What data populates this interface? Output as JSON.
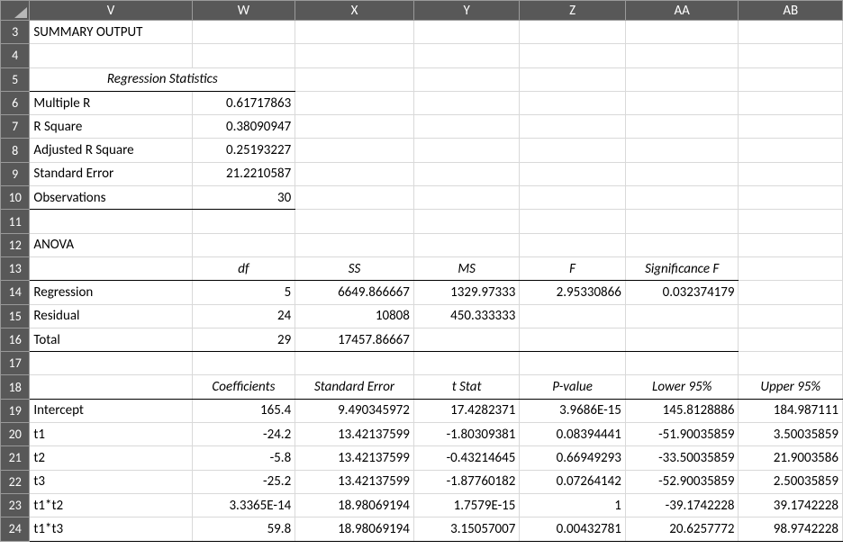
{
  "columns": [
    "V",
    "W",
    "X",
    "Y",
    "Z",
    "AA",
    "AB"
  ],
  "rowStart": 3,
  "rowEnd": 24,
  "summary": {
    "title": "SUMMARY OUTPUT",
    "heading": "Regression Statistics",
    "rows": [
      {
        "label": "Multiple R",
        "value": "0.61717863"
      },
      {
        "label": "R Square",
        "value": "0.38090947"
      },
      {
        "label": "Adjusted R Square",
        "value": "0.25193227"
      },
      {
        "label": "Standard Error",
        "value": "21.2210587"
      },
      {
        "label": "Observations",
        "value": "30"
      }
    ]
  },
  "anova": {
    "title": "ANOVA",
    "headers": {
      "df": "df",
      "ss": "SS",
      "ms": "MS",
      "f": "F",
      "sigf": "Significance F"
    },
    "rows": [
      {
        "label": "Regression",
        "df": "5",
        "ss": "6649.866667",
        "ms": "1329.97333",
        "f": "2.95330866",
        "sigf": "0.032374179"
      },
      {
        "label": "Residual",
        "df": "24",
        "ss": "10808",
        "ms": "450.333333",
        "f": "",
        "sigf": ""
      },
      {
        "label": "Total",
        "df": "29",
        "ss": "17457.86667",
        "ms": "",
        "f": "",
        "sigf": ""
      }
    ]
  },
  "coef": {
    "headers": {
      "coef": "Coefficients",
      "se": "Standard Error",
      "t": "t Stat",
      "p": "P-value",
      "lo": "Lower 95%",
      "hi": "Upper 95%"
    },
    "rows": [
      {
        "label": "Intercept",
        "coef": "165.4",
        "se": "9.490345972",
        "t": "17.4282371",
        "p": "3.9686E-15",
        "lo": "145.8128886",
        "hi": "184.987111"
      },
      {
        "label": "t1",
        "coef": "-24.2",
        "se": "13.42137599",
        "t": "-1.80309381",
        "p": "0.08394441",
        "lo": "-51.90035859",
        "hi": "3.50035859"
      },
      {
        "label": "t2",
        "coef": "-5.8",
        "se": "13.42137599",
        "t": "-0.43214645",
        "p": "0.66949293",
        "lo": "-33.50035859",
        "hi": "21.9003586"
      },
      {
        "label": "t3",
        "coef": "-25.2",
        "se": "13.42137599",
        "t": "-1.87760182",
        "p": "0.07264142",
        "lo": "-52.90035859",
        "hi": "2.50035859"
      },
      {
        "label": "t1*t2",
        "coef": "3.3365E-14",
        "se": "18.98069194",
        "t": "1.7579E-15",
        "p": "1",
        "lo": "-39.1742228",
        "hi": "39.1742228"
      },
      {
        "label": "t1*t3",
        "coef": "59.8",
        "se": "18.98069194",
        "t": "3.15057007",
        "p": "0.00432781",
        "lo": "20.6257772",
        "hi": "98.9742228"
      }
    ]
  }
}
